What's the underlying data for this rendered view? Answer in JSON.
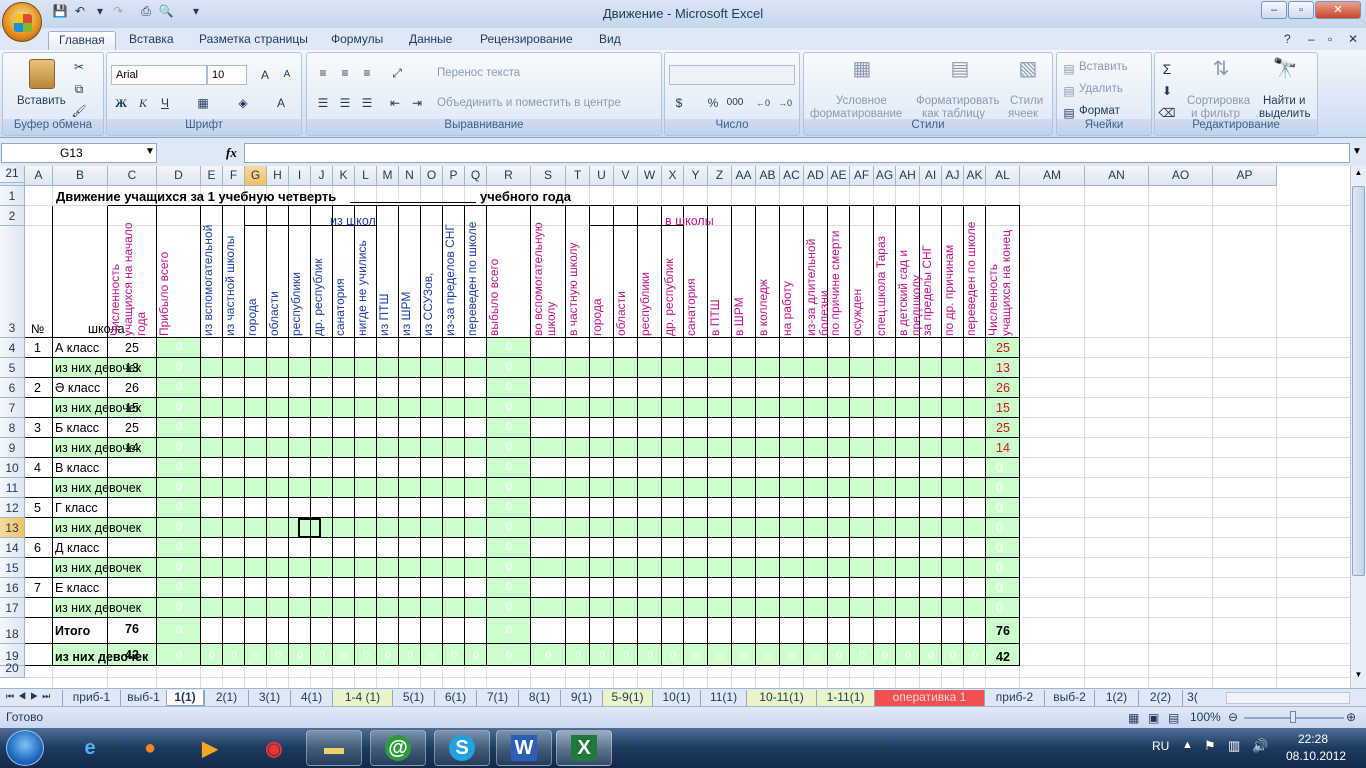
{
  "window": {
    "title": "Движение - Microsoft Excel"
  },
  "tabs": [
    "Главная",
    "Вставка",
    "Разметка страницы",
    "Формулы",
    "Данные",
    "Рецензирование",
    "Вид"
  ],
  "ribbon": {
    "clipboard": {
      "paste": "Вставить",
      "label": "Буфер обмена"
    },
    "font": {
      "name": "Arial",
      "size": "10",
      "label": "Шрифт"
    },
    "alignment": {
      "wrap": "Перенос текста",
      "merge": "Объединить и поместить в центре",
      "label": "Выравнивание"
    },
    "number": {
      "label": "Число",
      "percent": "%",
      "thousands": "000"
    },
    "styles": {
      "cond_line1": "Условное",
      "cond_line2": "форматирование",
      "table_line1": "Форматировать",
      "table_line2": "как таблицу",
      "cell_line1": "Стили",
      "cell_line2": "ячеек",
      "label": "Стили"
    },
    "cells": {
      "insert": "Вставить",
      "delete": "Удалить",
      "format": "Формат",
      "label": "Ячейки"
    },
    "editing": {
      "sort_line1": "Сортировка",
      "sort_line2": "и фильтр",
      "find_line1": "Найти и",
      "find_line2": "выделить",
      "label": "Редактирование"
    }
  },
  "formula_bar": {
    "name_box": "G13",
    "fx": "fx",
    "formula": ""
  },
  "columns": [
    "A",
    "B",
    "C",
    "D",
    "E",
    "F",
    "G",
    "H",
    "I",
    "J",
    "K",
    "L",
    "M",
    "N",
    "O",
    "P",
    "Q",
    "R",
    "S",
    "T",
    "U",
    "V",
    "W",
    "X",
    "Y",
    "Z",
    "AA",
    "AB",
    "AC",
    "AD",
    "AE",
    "AF",
    "AG",
    "AH",
    "AI",
    "AJ",
    "AK",
    "AL",
    "AM",
    "AN",
    "AO",
    "AP"
  ],
  "rows": [
    "1",
    "2",
    "3",
    "4",
    "5",
    "6",
    "7",
    "8",
    "9",
    "10",
    "11",
    "12",
    "13",
    "14",
    "15",
    "16",
    "17",
    "18",
    "19",
    "20",
    "21"
  ],
  "sheet": {
    "title": "Движение учащихся за 1 учебную четверть",
    "title_suffix": "учебного года",
    "num_header": "№",
    "school_header": "школа",
    "from_schools": "из школ",
    "to_schools": "в школы",
    "v_headers": {
      "C": "Численность учащихся на начало года",
      "D": "Прибыло всего",
      "E": "из вспомогательной",
      "F": "из частной школы",
      "G": "города",
      "H": "области",
      "I": "республики",
      "J": "др. республик",
      "K": "санатория",
      "L": "нигде не учились",
      "M": "из ПТШ",
      "N": "из ШРМ",
      "O": "из ССУЗов,",
      "P": "из-за пределов СНГ",
      "Q": "переведен по школе",
      "R": "выбыло всего",
      "S": "во вспомогательную школу",
      "T": "в частную школу",
      "U": "города",
      "V": "области",
      "W": "республики",
      "X": "др. республик",
      "Y": "санатория",
      "Z": "в ПТШ",
      "AA": "в ШРМ",
      "AB": "в колледж",
      "AC": "на работу",
      "AD": "из-за длительной болезни",
      "AE": "по причине смерти",
      "AF": "осужден",
      "AG": "спец.школа Тараз",
      "AH": "в детский сад и предшколу",
      "AI": "за пределы СНГ",
      "AJ": "по др. причинам",
      "AK": "переведен по школе",
      "AL": "Численность учащихся на конец"
    },
    "body": [
      {
        "n": "1",
        "b": "А класс",
        "c": "25",
        "al": "25"
      },
      {
        "n": "",
        "b": "из них девочек",
        "c": "13",
        "al": "13"
      },
      {
        "n": "2",
        "b": "Ә класс",
        "c": "26",
        "al": "26"
      },
      {
        "n": "",
        "b": "из них девочек",
        "c": "15",
        "al": "15"
      },
      {
        "n": "3",
        "b": "Б класс",
        "c": "25",
        "al": "25"
      },
      {
        "n": "",
        "b": "из них девочек",
        "c": "14",
        "al": "14"
      },
      {
        "n": "4",
        "b": "В класс",
        "c": "",
        "al": "0"
      },
      {
        "n": "",
        "b": "из них девочек",
        "c": "",
        "al": "0"
      },
      {
        "n": "5",
        "b": "Г класс",
        "c": "",
        "al": "0"
      },
      {
        "n": "",
        "b": "из них девочек",
        "c": "",
        "al": "0"
      },
      {
        "n": "6",
        "b": "Д класс",
        "c": "",
        "al": "0"
      },
      {
        "n": "",
        "b": "из них девочек",
        "c": "",
        "al": "0"
      },
      {
        "n": "7",
        "b": "Е класс",
        "c": "",
        "al": "0"
      },
      {
        "n": "",
        "b": "из них девочек",
        "c": "",
        "al": "0"
      }
    ],
    "zero": "0",
    "total": {
      "b": "Итого",
      "c": "76",
      "al": "76"
    },
    "total_girls": {
      "b": "из них девочек",
      "c": "42",
      "al": "42"
    }
  },
  "sheet_tabs": [
    "приб-1",
    "выб-1",
    "1(1)",
    "2(1)",
    "3(1)",
    "4(1)",
    "1-4 (1)",
    "5(1)",
    "6(1)",
    "7(1)",
    "8(1)",
    "9(1)",
    "5-9(1)",
    "10(1)",
    "11(1)",
    "10-11(1)",
    "1-11(1)",
    "оперативка 1",
    "приб-2",
    "выб-2",
    "1(2)",
    "2(2)",
    "3("
  ],
  "active_sheet": "1(1)",
  "status": {
    "ready": "Готово",
    "zoom": "100%"
  },
  "taskbar": {
    "lang": "RU",
    "time": "22:28",
    "date": "08.10.2012"
  },
  "colors": {
    "accent": "#1e395b",
    "green_cell": "#ccffcc",
    "magenta": "#c0148c",
    "red": "#dd1111"
  }
}
